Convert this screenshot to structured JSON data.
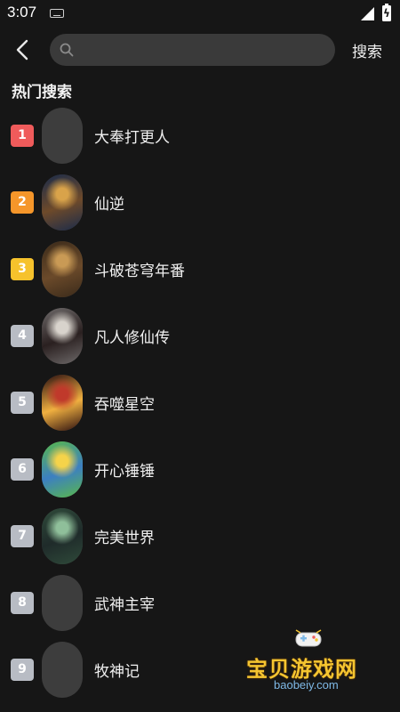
{
  "status_bar": {
    "time": "3:07",
    "icons": [
      "keyboard-icon",
      "signal-icon",
      "battery-charging-icon"
    ]
  },
  "header": {
    "back_icon": "chevron-left-icon",
    "search_icon": "search-icon",
    "search_placeholder": "",
    "search_value": "",
    "search_button": "搜索"
  },
  "hot": {
    "title": "热门搜索",
    "items": [
      {
        "rank": "1",
        "name": "大奉打更人",
        "badge_color": "#ef5b5b",
        "cover": "blank"
      },
      {
        "rank": "2",
        "name": "仙逆",
        "badge_color": "#f5962a",
        "cover": "poster"
      },
      {
        "rank": "3",
        "name": "斗破苍穹年番",
        "badge_color": "#f6c22c",
        "cover": "poster"
      },
      {
        "rank": "4",
        "name": "凡人修仙传",
        "badge_color": "#b8bcc4",
        "cover": "poster"
      },
      {
        "rank": "5",
        "name": "吞噬星空",
        "badge_color": "#b8bcc4",
        "cover": "poster"
      },
      {
        "rank": "6",
        "name": "开心锤锤",
        "badge_color": "#b8bcc4",
        "cover": "poster"
      },
      {
        "rank": "7",
        "name": "完美世界",
        "badge_color": "#b8bcc4",
        "cover": "poster"
      },
      {
        "rank": "8",
        "name": "武神主宰",
        "badge_color": "#b8bcc4",
        "cover": "blank"
      },
      {
        "rank": "9",
        "name": "牧神记",
        "badge_color": "#b8bcc4",
        "cover": "blank"
      }
    ]
  },
  "watermark": {
    "text": "宝贝游戏网",
    "url": "baobeiy.com"
  }
}
